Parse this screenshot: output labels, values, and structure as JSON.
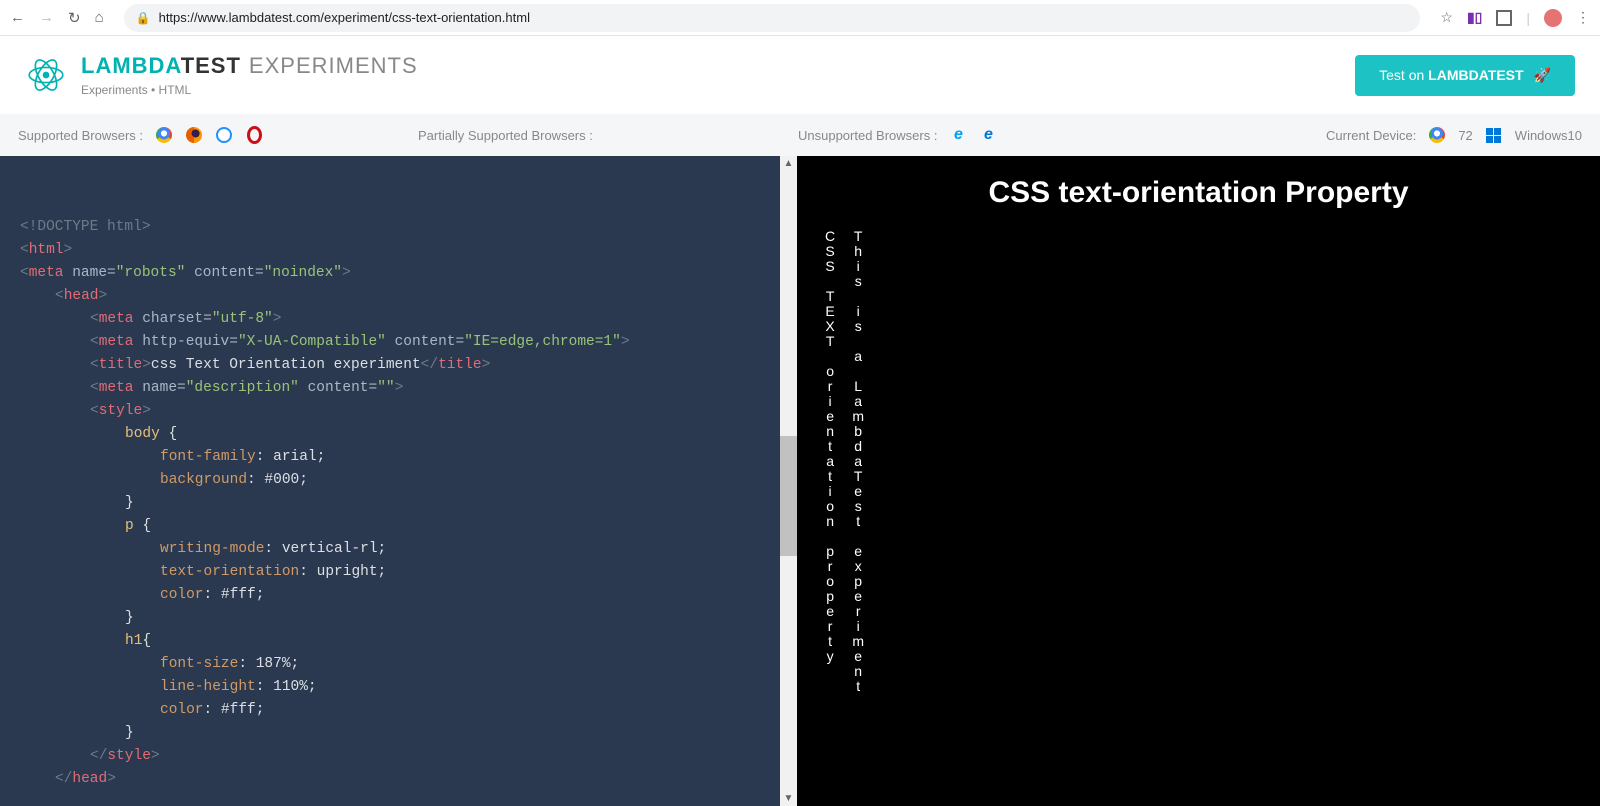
{
  "browser": {
    "url": "https://www.lambdatest.com/experiment/css-text-orientation.html"
  },
  "header": {
    "brand_lambda": "LAMBDA",
    "brand_test": "TEST",
    "brand_exp": "EXPERIMENTS",
    "sub": "Experiments • HTML",
    "cta_prefix": "Test on ",
    "cta_bold": "LAMBDATEST"
  },
  "metabar": {
    "supported_label": "Supported Browsers :",
    "partial_label": "Partially Supported Browsers :",
    "unsupported_label": "Unsupported Browsers :",
    "device_label": "Current Device:",
    "device_ver": "72",
    "device_os": "Windows10"
  },
  "code": [
    {
      "cls": "",
      "html": "<span class='c-gray'>&lt;!DOCTYPE html&gt;</span>"
    },
    {
      "cls": "",
      "html": "<span class='c-gray'>&lt;</span><span class='c-orange'>html</span><span class='c-gray'>&gt;</span>"
    },
    {
      "cls": "",
      "html": "<span class='c-gray'>&lt;</span><span class='c-orange'>meta</span> <span class='c-attr'>name</span>=<span class='c-green'>\"robots\"</span> <span class='c-attr'>content</span>=<span class='c-green'>\"noindex\"</span><span class='c-gray'>&gt;</span>"
    },
    {
      "cls": "ind1",
      "html": "<span class='c-gray'>&lt;</span><span class='c-orange'>head</span><span class='c-gray'>&gt;</span>"
    },
    {
      "cls": "ind2",
      "html": "<span class='c-gray'>&lt;</span><span class='c-orange'>meta</span> <span class='c-attr'>charset</span>=<span class='c-green'>\"utf-8\"</span><span class='c-gray'>&gt;</span>"
    },
    {
      "cls": "ind2",
      "html": "<span class='c-gray'>&lt;</span><span class='c-orange'>meta</span> <span class='c-attr'>http-equiv</span>=<span class='c-green'>\"X-UA-Compatible\"</span> <span class='c-attr'>content</span>=<span class='c-green'>\"IE=edge,chrome=1\"</span><span class='c-gray'>&gt;</span>"
    },
    {
      "cls": "ind2",
      "html": "<span class='c-gray'>&lt;</span><span class='c-orange'>title</span><span class='c-gray'>&gt;</span><span class='c-white'>css Text Orientation experiment</span><span class='c-gray'>&lt;/</span><span class='c-orange'>title</span><span class='c-gray'>&gt;</span>"
    },
    {
      "cls": "ind2",
      "html": "<span class='c-gray'>&lt;</span><span class='c-orange'>meta</span> <span class='c-attr'>name</span>=<span class='c-green'>\"description\"</span> <span class='c-attr'>content</span>=<span class='c-green'>\"\"</span><span class='c-gray'>&gt;</span>"
    },
    {
      "cls": "ind2",
      "html": "<span class='c-gray'>&lt;</span><span class='c-orange'>style</span><span class='c-gray'>&gt;</span>"
    },
    {
      "cls": "ind3",
      "html": "<span class='c-sel'>body</span> <span class='c-white'>{</span>"
    },
    {
      "cls": "ind4",
      "html": "<span class='c-prop'>font-family</span><span class='c-white'>: arial;</span>"
    },
    {
      "cls": "ind4",
      "html": "<span class='c-prop'>background</span><span class='c-white'>: #000;</span>"
    },
    {
      "cls": "ind3",
      "html": "<span class='c-white'>}</span>"
    },
    {
      "cls": "ind3",
      "html": "<span class='c-sel'>p</span> <span class='c-white'>{</span>"
    },
    {
      "cls": "ind4",
      "html": "<span class='c-prop'>writing-mode</span><span class='c-white'>: vertical-rl;</span>"
    },
    {
      "cls": "ind4",
      "html": "<span class='c-prop'>text-orientation</span><span class='c-white'>: upright;</span>"
    },
    {
      "cls": "ind4",
      "html": "<span class='c-prop'>color</span><span class='c-white'>: #fff;</span>"
    },
    {
      "cls": "ind3",
      "html": "<span class='c-white'>}</span>"
    },
    {
      "cls": "ind3",
      "html": "<span class='c-sel'>h1</span><span class='c-white'>{</span>"
    },
    {
      "cls": "ind4",
      "html": "<span class='c-prop'>font-size</span><span class='c-white'>: 187%;</span>"
    },
    {
      "cls": "ind4",
      "html": "<span class='c-prop'>line-height</span><span class='c-white'>: 110%;</span>"
    },
    {
      "cls": "ind4",
      "html": "<span class='c-prop'>color</span><span class='c-white'>: #fff;</span>"
    },
    {
      "cls": "ind3",
      "html": "<span class='c-white'>}</span>"
    },
    {
      "cls": "ind2",
      "html": "<span class='c-gray'>&lt;/</span><span class='c-orange'>style</span><span class='c-gray'>&gt;</span>"
    },
    {
      "cls": "ind1",
      "html": "<span class='c-gray'>&lt;/</span><span class='c-orange'>head</span><span class='c-gray'>&gt;</span>"
    }
  ],
  "preview": {
    "heading": "CSS text-orientation Property",
    "p1": "CSS TEXT orientation property",
    "p2": "This is a LambdaTest experiment"
  }
}
